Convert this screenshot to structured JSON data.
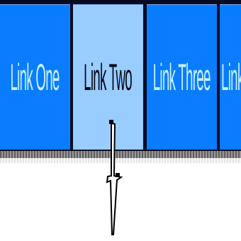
{
  "nav": {
    "links": [
      {
        "label": "Link One",
        "state": "normal"
      },
      {
        "label": "Link Two",
        "state": "hover"
      },
      {
        "label": "Link Three",
        "state": "normal"
      },
      {
        "label": "Link Four",
        "state": "normal"
      }
    ]
  },
  "colors": {
    "tab_normal": "#0a7cff",
    "tab_hover": "#99ccff",
    "tab_normal_text": "#c7f3ff",
    "tab_hover_text": "#020714",
    "separator": "#050c22"
  },
  "cursor": {
    "icon": "mouse-pointer-icon"
  }
}
